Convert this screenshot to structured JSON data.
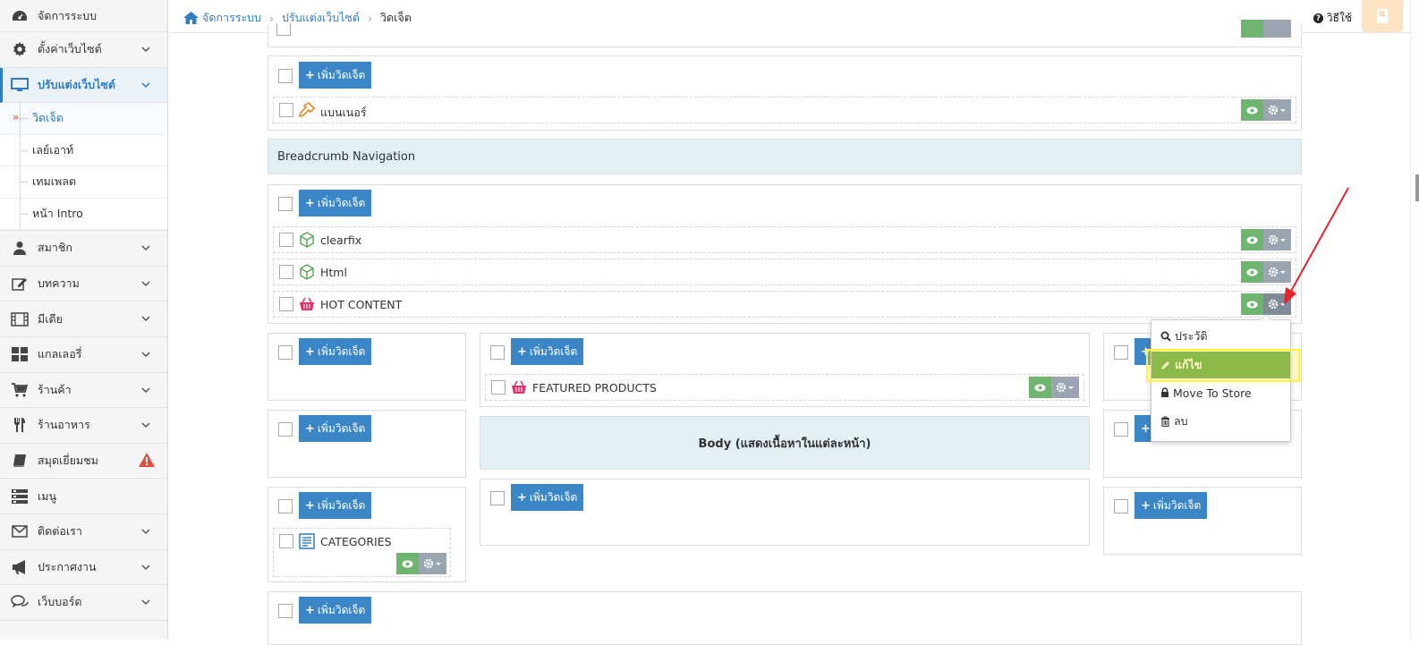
{
  "sidebar": {
    "top_item": "จัดการระบบ",
    "items": [
      {
        "label": "ตั้งค่าเว็บไซต์",
        "icon": "gear-icon"
      },
      {
        "label": "ปรับแต่งเว็บไซต์",
        "icon": "monitor-icon"
      },
      {
        "label": "สมาชิก",
        "icon": "user-icon"
      },
      {
        "label": "บทความ",
        "icon": "edit-icon"
      },
      {
        "label": "มีเดีย",
        "icon": "film-icon"
      },
      {
        "label": "แกลเลอรี่",
        "icon": "grid-icon"
      },
      {
        "label": "ร้านค้า",
        "icon": "cart-icon"
      },
      {
        "label": "ร้านอาหาร",
        "icon": "fork-knife-icon"
      },
      {
        "label": "สมุดเยี่ยมชม",
        "icon": "book-icon"
      },
      {
        "label": "เมนู",
        "icon": "menu-list-icon"
      },
      {
        "label": "ติดต่อเรา",
        "icon": "envelope-icon"
      },
      {
        "label": "ประกาศงาน",
        "icon": "megaphone-icon"
      },
      {
        "label": "เว็บบอร์ด",
        "icon": "chat-icon"
      }
    ],
    "submenu": [
      "วิดเจ็ต",
      "เลย์เอาท์",
      "เทมเพลต",
      "หน้า Intro"
    ],
    "submenu_marker": "»"
  },
  "breadcrumb": {
    "home": "จัดการระบบ",
    "section": "ปรับแต่งเว็บไซต์",
    "current": "วิดเจ็ต",
    "separator": "›"
  },
  "help": {
    "label": "วิธีใช้",
    "icon_glyph": "?"
  },
  "add_widget_label": "เพิ่มวิดเจ็ต",
  "plus_glyph": "+",
  "sections": {
    "breadcrumb_nav": "Breadcrumb Navigation",
    "body": "Body (แสดงเนื้อหาในแต่ละหน้า)"
  },
  "widgets": {
    "banner": "แบนเนอร์",
    "clearfix": "clearfix",
    "html": "Html",
    "hot_content": "HOT CONTENT",
    "featured_products": "FEATURED PRODUCTS",
    "categories": "CATEGORIES"
  },
  "dropdown": {
    "history": "ประวัติ",
    "edit": "แก้ไข",
    "move_to_store": "Move To Store",
    "delete": "ลบ"
  },
  "colors": {
    "primary": "#3b86c6",
    "eye": "#6fb46f",
    "gear": "#9aa5b1",
    "highlight": "#fff23b",
    "edit_active": "#4e9a47",
    "arrow": "#e8212a"
  }
}
